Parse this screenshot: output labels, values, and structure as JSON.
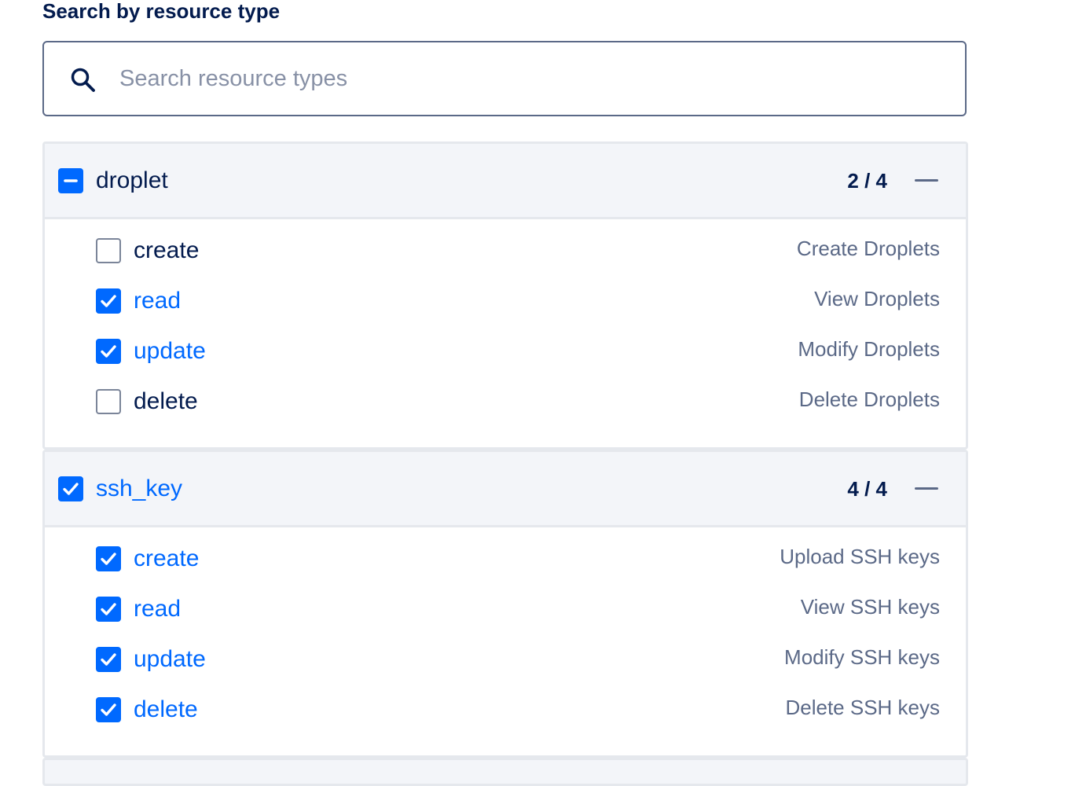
{
  "heading": "Search by resource type",
  "search": {
    "placeholder": "Search resource types",
    "value": ""
  },
  "colors": {
    "accent": "#0069ff",
    "text": "#031b4e",
    "muted": "#5b6987",
    "header_bg": "#f3f5f9",
    "border": "#e5e8ed"
  },
  "groups": [
    {
      "name": "droplet",
      "state": "indeterminate",
      "count": "2 / 4",
      "collapse_icon": "minus-icon",
      "permissions": [
        {
          "name": "create",
          "checked": false,
          "description": "Create Droplets"
        },
        {
          "name": "read",
          "checked": true,
          "description": "View Droplets"
        },
        {
          "name": "update",
          "checked": true,
          "description": "Modify Droplets"
        },
        {
          "name": "delete",
          "checked": false,
          "description": "Delete Droplets"
        }
      ]
    },
    {
      "name": "ssh_key",
      "state": "checked",
      "count": "4 / 4",
      "collapse_icon": "minus-icon",
      "permissions": [
        {
          "name": "create",
          "checked": true,
          "description": "Upload SSH keys"
        },
        {
          "name": "read",
          "checked": true,
          "description": "View SSH keys"
        },
        {
          "name": "update",
          "checked": true,
          "description": "Modify SSH keys"
        },
        {
          "name": "delete",
          "checked": true,
          "description": "Delete SSH keys"
        }
      ]
    }
  ]
}
